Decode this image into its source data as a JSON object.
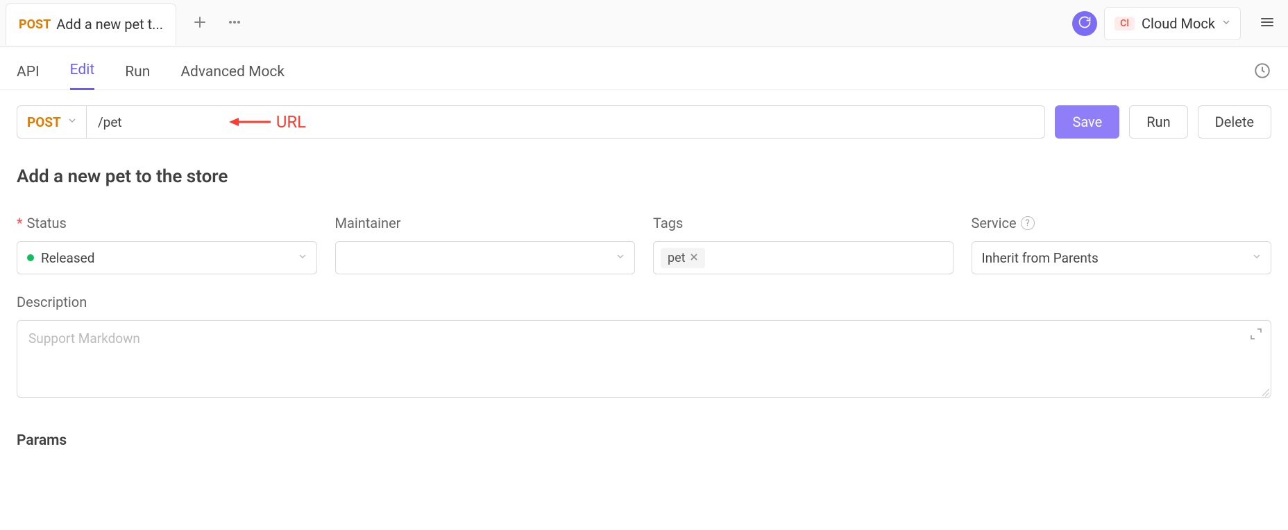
{
  "colors": {
    "accent": "#8f7ef7",
    "method_post": "#e07c00",
    "annotation": "#ff3b2f",
    "status_released": "#0fbf5f"
  },
  "tabbar": {
    "active_tab": {
      "method": "POST",
      "title": "Add a new pet t..."
    },
    "env": {
      "badge": "Cl",
      "label": "Cloud Mock"
    }
  },
  "subnav": {
    "items": [
      {
        "label": "API",
        "active": false
      },
      {
        "label": "Edit",
        "active": true
      },
      {
        "label": "Run",
        "active": false
      },
      {
        "label": "Advanced Mock",
        "active": false
      }
    ]
  },
  "request": {
    "method": "POST",
    "url": "/pet",
    "annotation": "URL",
    "buttons": {
      "save": "Save",
      "run": "Run",
      "delete": "Delete"
    }
  },
  "heading": "Add a new pet to the store",
  "fields": {
    "status": {
      "label": "Status",
      "required": true,
      "value": "Released"
    },
    "maintainer": {
      "label": "Maintainer",
      "value": ""
    },
    "tags": {
      "label": "Tags",
      "values": [
        "pet"
      ]
    },
    "service": {
      "label": "Service",
      "value": "Inherit from Parents",
      "help": true
    }
  },
  "description": {
    "label": "Description",
    "placeholder": "Support Markdown"
  },
  "params_heading": "Params"
}
